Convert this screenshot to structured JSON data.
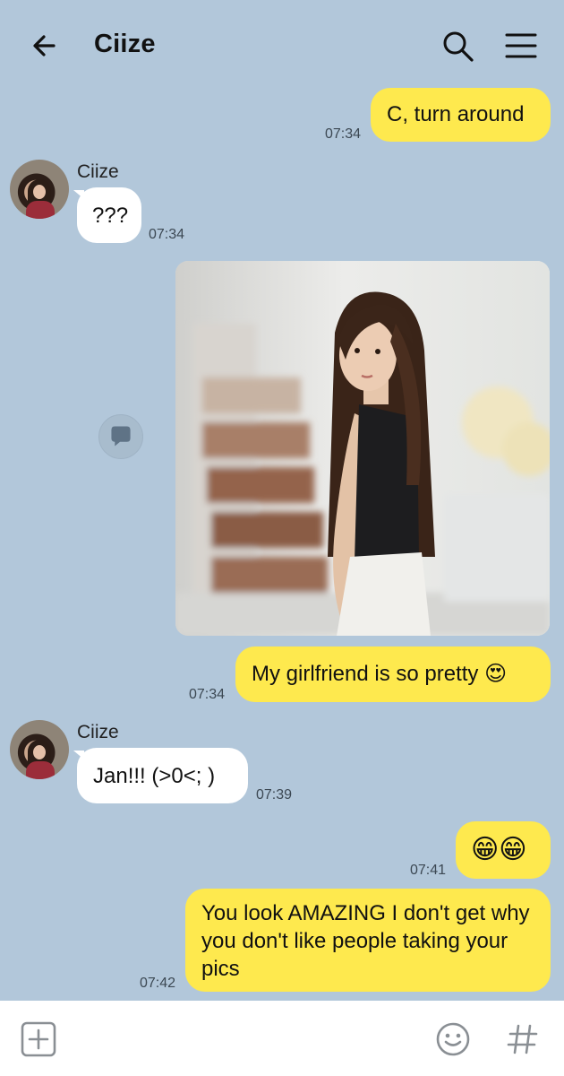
{
  "header": {
    "title": "Ciize"
  },
  "messages": {
    "m1": {
      "text": "C, turn around",
      "time": "07:34"
    },
    "m2": {
      "sender": "Ciize",
      "text": "???",
      "time": "07:34"
    },
    "m3": {
      "text": "My girlfriend is so pretty 😍",
      "time": "07:34"
    },
    "m4": {
      "sender": "Ciize",
      "text": "Jan!!! (>0<;  )",
      "time": "07:39"
    },
    "m5": {
      "text": "😁😁",
      "time": "07:41"
    },
    "m6": {
      "text": "You look AMAZING I don't get why you don't like people taking your pics",
      "time": "07:42"
    }
  },
  "colors": {
    "background": "#b2c7da",
    "my_bubble": "#fee94e",
    "their_bubble": "#ffffff"
  },
  "icons": [
    "back-arrow-icon",
    "search-icon",
    "menu-icon",
    "share-icon",
    "add-icon",
    "emoji-icon",
    "hashtag-icon"
  ]
}
